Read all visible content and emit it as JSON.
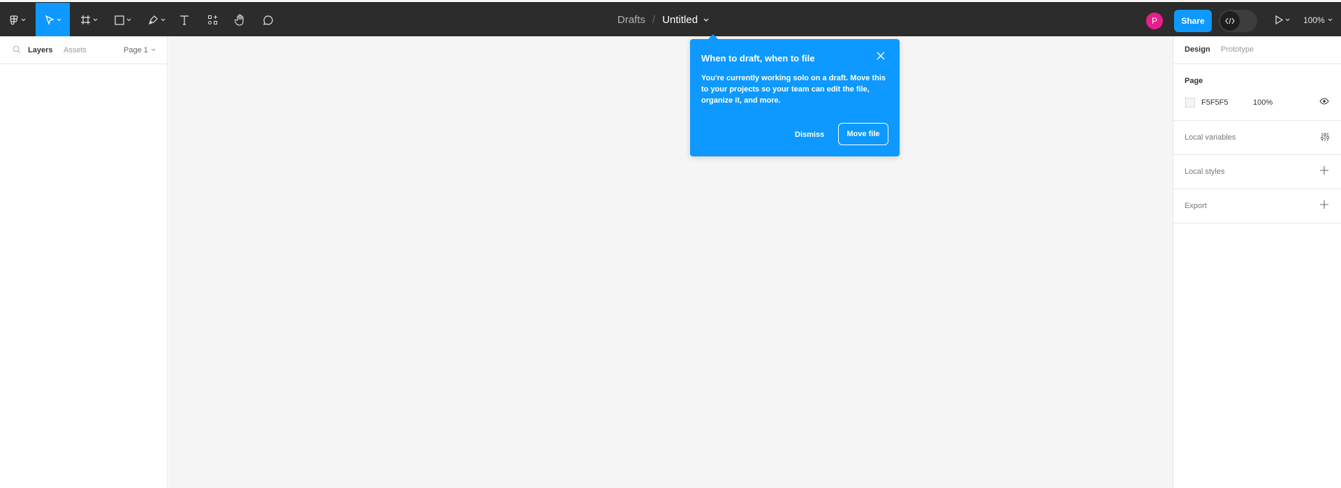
{
  "toolbar": {
    "breadcrumb_parent": "Drafts",
    "breadcrumb_separator": "/",
    "file_title": "Untitled",
    "avatar_initial": "P",
    "share_label": "Share",
    "zoom_level": "100%"
  },
  "left_panel": {
    "tab_layers": "Layers",
    "tab_assets": "Assets",
    "page_selector": "Page 1"
  },
  "right_panel": {
    "tab_design": "Design",
    "tab_prototype": "Prototype",
    "page_label": "Page",
    "page_color_hex": "F5F5F5",
    "page_opacity": "100%",
    "local_variables": "Local variables",
    "local_styles": "Local styles",
    "export": "Export"
  },
  "popover": {
    "title": "When to draft, when to file",
    "body": "You're currently working solo on a draft. Move this to your projects so your team can edit the file, organize it, and more.",
    "dismiss_label": "Dismiss",
    "move_label": "Move file"
  },
  "colors": {
    "accent": "#0d99ff",
    "toolbar_bg": "#2c2c2c",
    "canvas_bg": "#f5f5f5",
    "avatar_bg": "#e91e8c"
  },
  "icons": [
    "figma-menu-icon",
    "move-tool-icon",
    "frame-tool-icon",
    "shape-tool-icon",
    "pen-tool-icon",
    "text-tool-icon",
    "resources-icon",
    "hand-tool-icon",
    "comment-icon",
    "dev-mode-icon",
    "present-icon",
    "search-icon",
    "eye-icon",
    "variables-icon",
    "plus-icon",
    "close-icon"
  ]
}
